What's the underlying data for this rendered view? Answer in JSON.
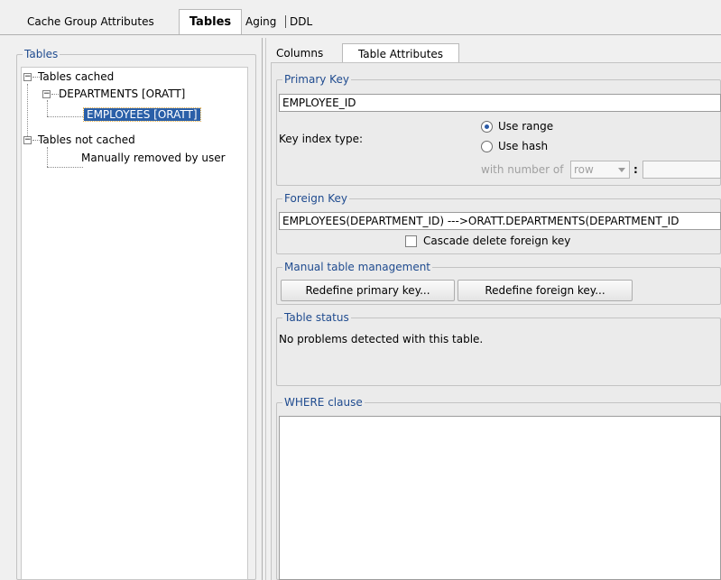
{
  "top_tabs": [
    {
      "label": "Cache Group Attributes"
    },
    {
      "label": "Tables"
    },
    {
      "label": "Aging"
    },
    {
      "label": "DDL"
    }
  ],
  "left": {
    "group_title": "Tables",
    "tree": {
      "cached": "Tables cached",
      "departments": "DEPARTMENTS [ORATT]",
      "employees": "EMPLOYEES [ORATT]",
      "not_cached": "Tables not cached",
      "removed": "Manually removed by user"
    }
  },
  "right": {
    "tabs": [
      {
        "label": "Columns"
      },
      {
        "label": "Table Attributes"
      }
    ],
    "primary_key": {
      "title": "Primary Key",
      "value": "EMPLOYEE_ID",
      "key_index_label": "Key index type:",
      "use_range": "Use range",
      "use_hash": "Use hash",
      "with_number_of": "with number of",
      "unit": "row",
      "colon": ":"
    },
    "foreign_key": {
      "title": "Foreign Key",
      "value": "EMPLOYEES(DEPARTMENT_ID) --->ORATT.DEPARTMENTS(DEPARTMENT_ID",
      "cascade_label": "Cascade delete foreign key"
    },
    "manual": {
      "title": "Manual table management",
      "redefine_primary": "Redefine primary key...",
      "redefine_foreign": "Redefine foreign key..."
    },
    "status": {
      "title": "Table status",
      "text": "No problems detected with this table."
    },
    "where": {
      "title": "WHERE clause",
      "value": ""
    }
  }
}
